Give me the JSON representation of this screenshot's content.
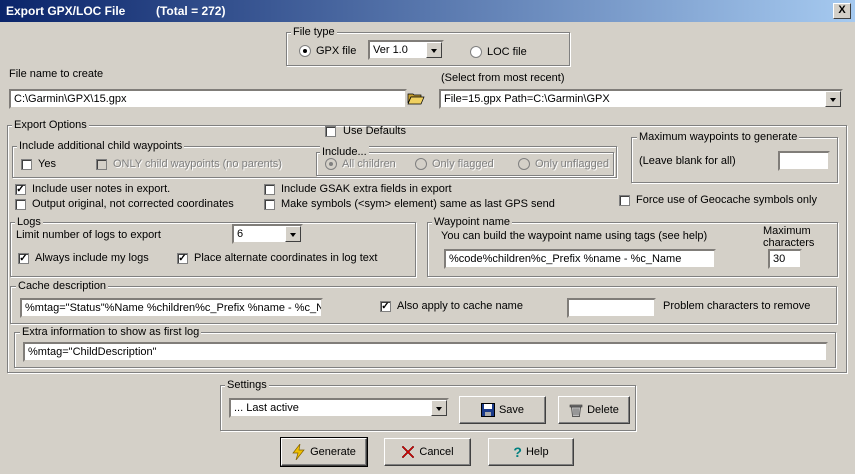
{
  "window": {
    "title": "Export GPX/LOC File",
    "total": "(Total = 272)",
    "close": "X"
  },
  "file_type": {
    "legend": "File type",
    "gpx_label": "GPX file",
    "version_value": "Ver 1.0",
    "loc_label": "LOC file",
    "gpx_selected": true
  },
  "file_name": {
    "label": "File name to create",
    "value": "C:\\Garmin\\GPX\\15.gpx"
  },
  "recent": {
    "label": "(Select from most recent)",
    "value": "File=15.gpx Path=C:\\Garmin\\GPX"
  },
  "export_options": {
    "legend": "Export Options",
    "use_defaults": "Use Defaults",
    "child_group": {
      "legend": "Include additional child waypoints",
      "yes": "Yes",
      "only_child": "ONLY child waypoints (no parents)"
    },
    "include_group": {
      "legend": "Include...",
      "all": "All children",
      "flagged": "Only flagged",
      "unflagged": "Only unflagged"
    },
    "max_wp": {
      "legend": "Maximum waypoints to generate",
      "hint": "(Leave blank for all)",
      "value": ""
    },
    "user_notes": "Include user notes in export.",
    "original_coords": "Output original, not corrected coordinates",
    "gsak_extra": "Include GSAK extra fields in export",
    "make_symbols": "Make symbols (<sym> element) same as last GPS send",
    "force_symbols": "Force use of Geocache symbols only"
  },
  "logs": {
    "legend": "Logs",
    "limit_label": "Limit number of logs to export",
    "limit_value": "6",
    "always_mine": "Always include my logs",
    "place_alt": "Place alternate coordinates in log text"
  },
  "waypoint_name": {
    "legend": "Waypoint name",
    "hint": "You can build the waypoint name using tags (see help)",
    "value": "%code%children%c_Prefix %name - %c_Name",
    "max_label_1": "Maximum",
    "max_label_2": "characters",
    "max_value": "30"
  },
  "cache_desc": {
    "legend": "Cache description",
    "value": "%mtag=\"Status\"%Name %children%c_Prefix %name - %c_Nam",
    "apply_name": "Also apply to cache name",
    "problem_value": "",
    "problem_label": "Problem characters to remove"
  },
  "extra_info": {
    "legend": "Extra information to show as first log",
    "value": "%mtag=\"ChildDescription\""
  },
  "settings": {
    "legend": "Settings",
    "value": "... Last active",
    "save": "Save",
    "delete": "Delete"
  },
  "buttons": {
    "generate": "Generate",
    "cancel": "Cancel",
    "help": "Help"
  }
}
